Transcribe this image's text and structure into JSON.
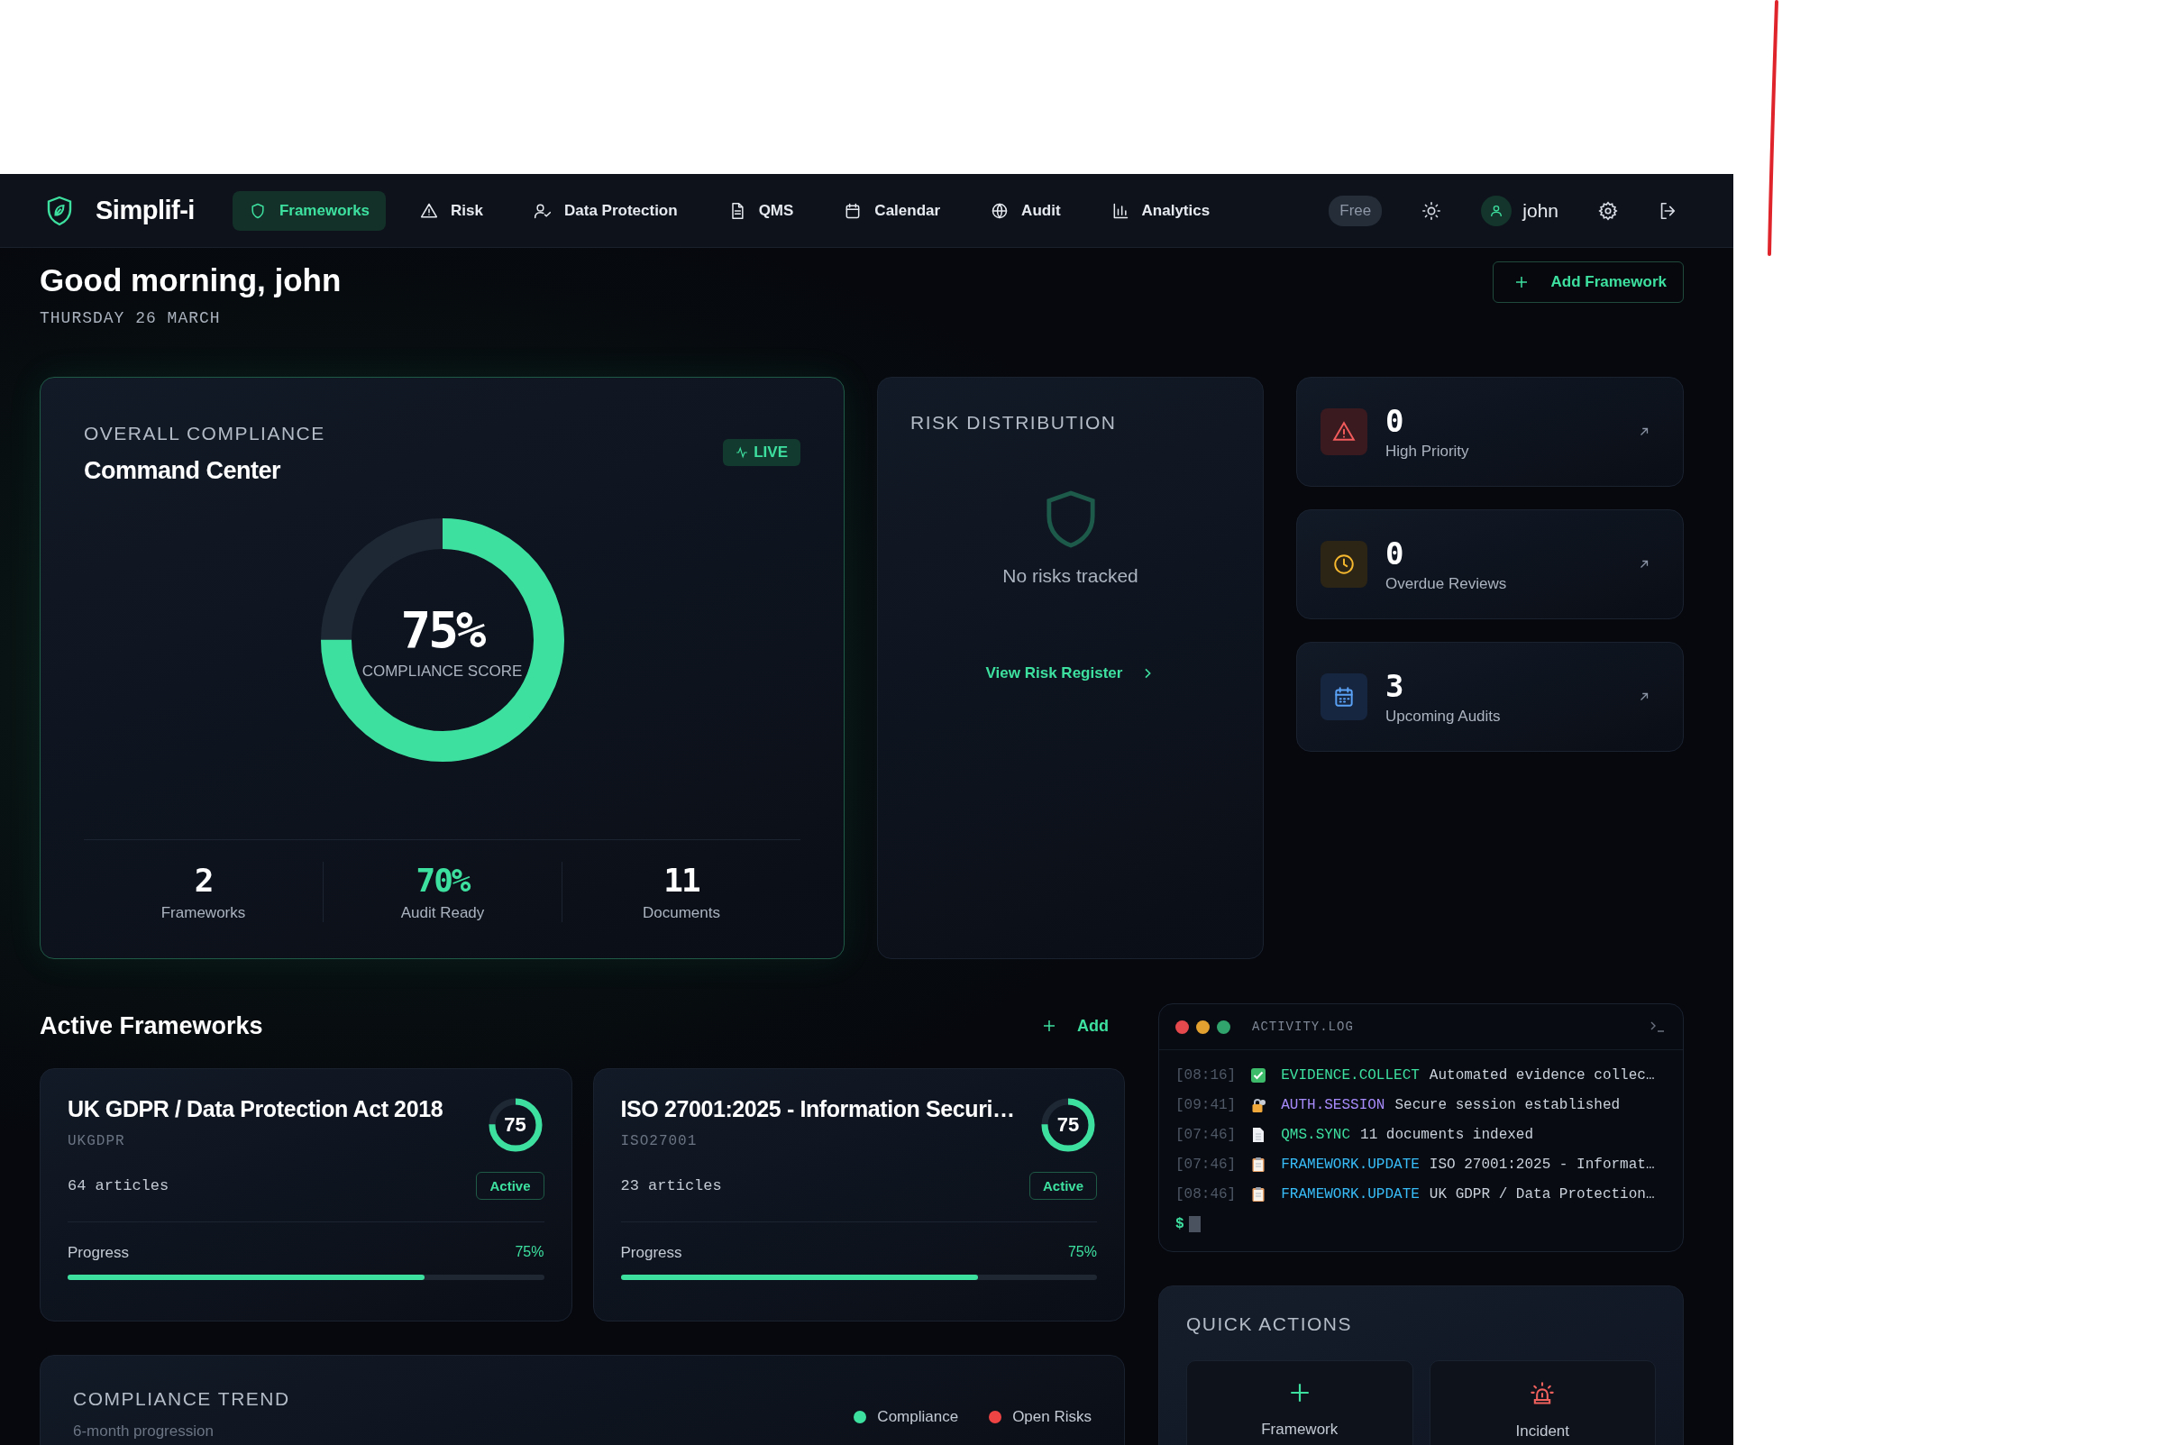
{
  "nav": {
    "brand": "Simplif-i",
    "items": [
      {
        "kind": "shield",
        "label": "Frameworks",
        "selected": true
      },
      {
        "kind": "triangle",
        "label": "Risk",
        "selected": false
      },
      {
        "kind": "user-check",
        "label": "Data Protection",
        "selected": false
      },
      {
        "kind": "file",
        "label": "QMS",
        "selected": false
      },
      {
        "kind": "calendar",
        "label": "Calendar",
        "selected": false
      },
      {
        "kind": "globe",
        "label": "Audit",
        "selected": false
      },
      {
        "kind": "bars",
        "label": "Analytics",
        "selected": false
      }
    ],
    "plan_badge": "Free",
    "user": "john"
  },
  "header": {
    "greeting": "Good morning, john",
    "date": "THURSDAY 26 MARCH",
    "add_button": "Add Framework"
  },
  "compliance": {
    "eyebrow": "OVERALL COMPLIANCE",
    "title": "Command Center",
    "live_badge": "LIVE",
    "gauge": {
      "value": "75%",
      "label": "COMPLIANCE SCORE",
      "level": 0.75
    },
    "stats": [
      {
        "value": "2",
        "label": "Frameworks",
        "highlight": false
      },
      {
        "value": "70%",
        "label": "Audit Ready",
        "highlight": true
      },
      {
        "value": "11",
        "label": "Documents",
        "highlight": false
      }
    ]
  },
  "risk_distribution": {
    "title": "RISK DISTRIBUTION",
    "empty_text": "No risks tracked",
    "link": "View Risk Register"
  },
  "stat_cards": [
    {
      "kind": "alert",
      "value": "0",
      "label": "High Priority"
    },
    {
      "kind": "clock",
      "value": "0",
      "label": "Overdue Reviews"
    },
    {
      "kind": "calendar",
      "value": "3",
      "label": "Upcoming Audits"
    }
  ],
  "active_frameworks": {
    "title": "Active Frameworks",
    "add": "Add",
    "cards": [
      {
        "name": "UK GDPR / Data Protection Act 2018",
        "code": "UKGDPR",
        "ring": {
          "value": "75",
          "level": 0.75
        },
        "articles": "64 articles",
        "status": "Active",
        "progress": {
          "label": "Progress",
          "value": "75%",
          "level": 0.75
        }
      },
      {
        "name": "ISO 27001:2025 - Information Securi…",
        "code": "ISO27001",
        "ring": {
          "value": "75",
          "level": 0.75
        },
        "articles": "23 articles",
        "status": "Active",
        "progress": {
          "label": "Progress",
          "value": "75%",
          "level": 0.75
        }
      }
    ]
  },
  "compliance_trend": {
    "title": "COMPLIANCE TREND",
    "subtitle": "6-month progression",
    "legend": [
      {
        "label": "Compliance",
        "color": "#3ee0a0"
      },
      {
        "label": "Open Risks",
        "color": "#ef4444"
      }
    ]
  },
  "activity_log": {
    "title": "ACTIVITY.LOG",
    "entries": [
      {
        "time": "[08:16]",
        "kind": "check",
        "event": "EVIDENCE.COLLECT",
        "color": "#3ee0a0",
        "message": "Automated evidence collec…"
      },
      {
        "time": "[09:41]",
        "kind": "lock",
        "event": "AUTH.SESSION",
        "color": "#a78bfa",
        "message": "Secure session established"
      },
      {
        "time": "[07:46]",
        "kind": "document",
        "event": "QMS.SYNC",
        "color": "#3ee0a0",
        "message": "11 documents indexed"
      },
      {
        "time": "[07:46]",
        "kind": "clipboard",
        "event": "FRAMEWORK.UPDATE",
        "color": "#38bdf8",
        "message": "ISO 27001:2025 - Informat…"
      },
      {
        "time": "[08:46]",
        "kind": "clipboard",
        "event": "FRAMEWORK.UPDATE",
        "color": "#38bdf8",
        "message": "UK GDPR / Data Protection…"
      }
    ],
    "prompt": "$"
  },
  "quick_actions": {
    "title": "QUICK ACTIONS",
    "actions": [
      {
        "kind": "add",
        "label": "Framework"
      },
      {
        "kind": "incident",
        "label": "Incident"
      }
    ]
  }
}
